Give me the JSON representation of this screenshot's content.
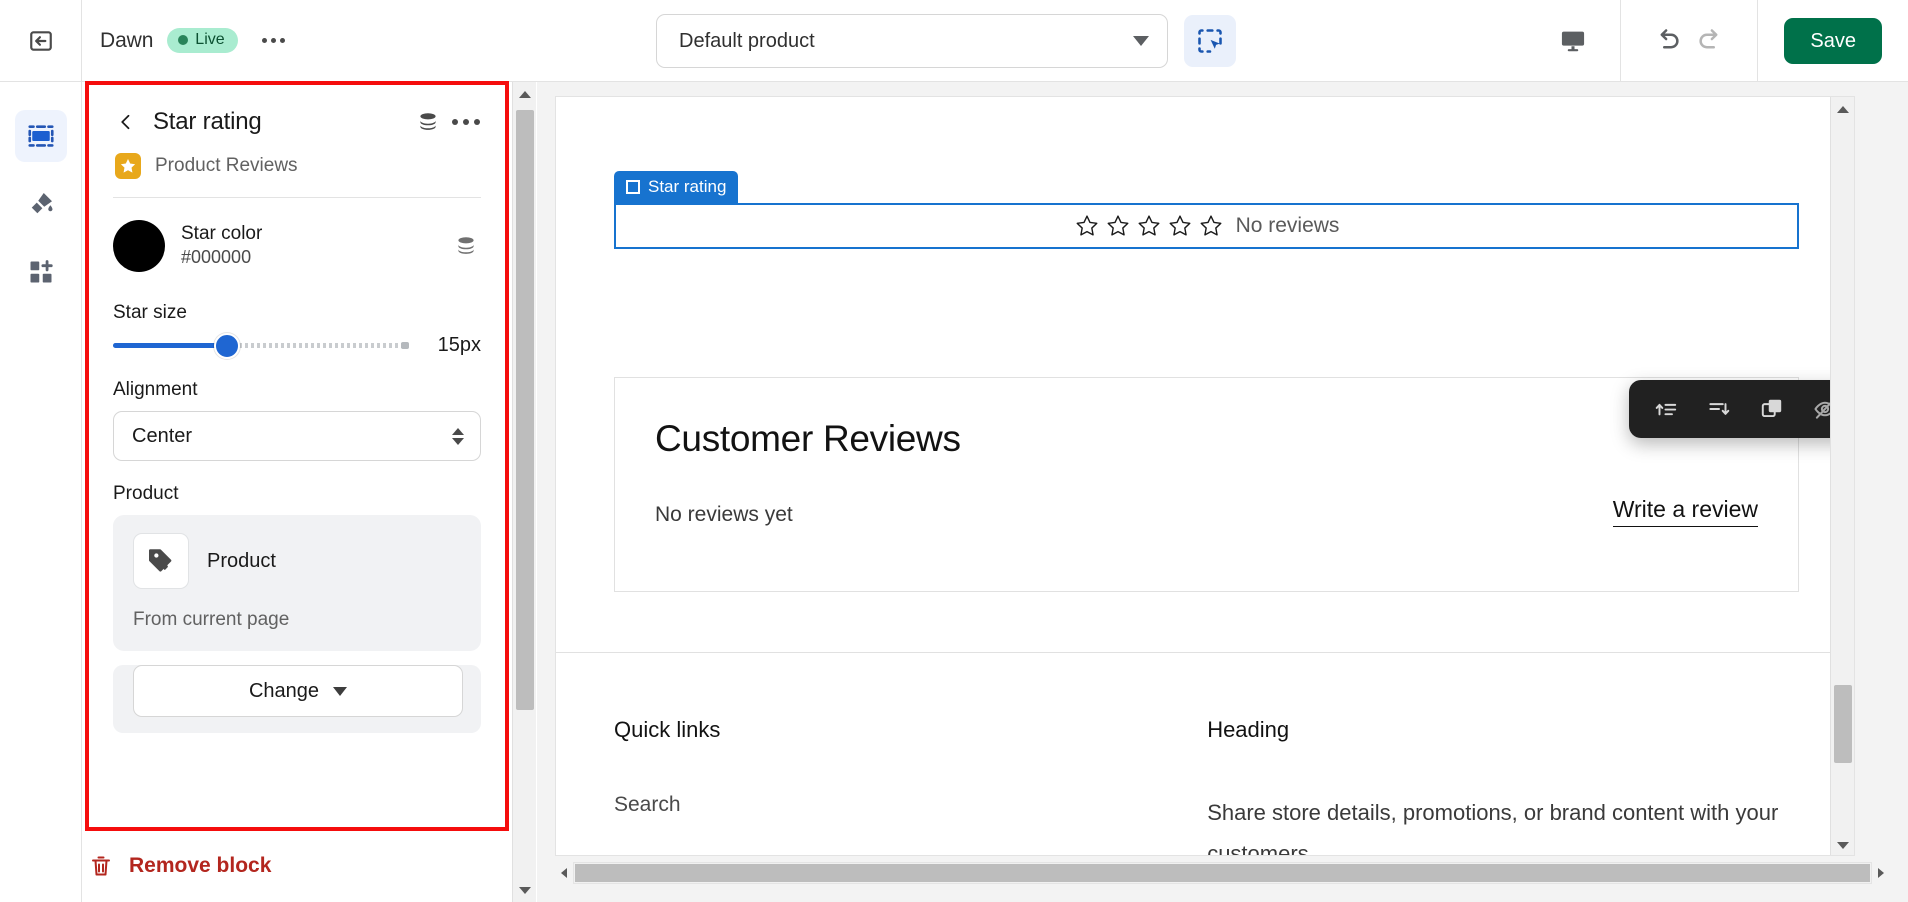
{
  "topbar": {
    "exit_icon": "exit-arrow-icon",
    "theme_name": "Dawn",
    "live_label": "Live",
    "more_icon": "ellipsis-icon",
    "page_selector": {
      "value": "Default product",
      "chevron": "chevron-down-icon"
    },
    "select_tool_icon": "select-area-cursor-icon",
    "device_icon": "desktop-icon",
    "undo_icon": "undo-icon",
    "redo_icon": "redo-icon",
    "save_label": "Save"
  },
  "rail": {
    "items": [
      {
        "name": "sections",
        "icon": "sections-icon",
        "active": true
      },
      {
        "name": "theme-settings",
        "icon": "paint-brush-icon",
        "active": false
      },
      {
        "name": "apps",
        "icon": "apps-grid-plus-icon",
        "active": false
      }
    ]
  },
  "sidebar": {
    "back_icon": "chevron-left-icon",
    "title": "Star rating",
    "stack_icon": "database-stack-icon",
    "more_icon": "ellipsis-icon",
    "app_badge_icon": "star-icon",
    "app_name": "Product Reviews",
    "color": {
      "label": "Star color",
      "hex": "#000000",
      "swatch_color": "#000000",
      "stack_icon": "database-stack-icon"
    },
    "star_size": {
      "label": "Star size",
      "value": "15px",
      "fill_percent": 38,
      "accent": "#1f66d2"
    },
    "alignment": {
      "label": "Alignment",
      "value": "Center"
    },
    "product": {
      "label": "Product",
      "card_icon": "product-tag-icon",
      "card_title": "Product",
      "source": "From current page",
      "change_label": "Change",
      "change_caret": "caret-down-icon"
    },
    "remove_block": {
      "label": "Remove block",
      "icon": "trash-icon",
      "color": "#b3261e"
    }
  },
  "preview": {
    "block_tab": {
      "label": "Star rating",
      "icon": "frame-corners-icon",
      "color": "#1773cf"
    },
    "star_rating": {
      "stars": 5,
      "filled": 0,
      "text": "No reviews"
    },
    "floating_toolbar": [
      {
        "name": "move-up-button",
        "icon": "move-up-icon"
      },
      {
        "name": "move-down-button",
        "icon": "move-down-icon"
      },
      {
        "name": "duplicate-button",
        "icon": "duplicate-icon"
      },
      {
        "name": "hide-button",
        "icon": "eye-off-icon"
      },
      {
        "name": "delete-button",
        "icon": "trash-icon",
        "color": "#e5484d"
      }
    ],
    "reviews": {
      "title": "Customer Reviews",
      "empty_text": "No reviews yet",
      "write_link": "Write a review"
    },
    "footer": {
      "quick_links_heading": "Quick links",
      "quick_links": [
        "Search"
      ],
      "heading": "Heading",
      "text": "Share store details, promotions, or brand content with your customers."
    }
  }
}
